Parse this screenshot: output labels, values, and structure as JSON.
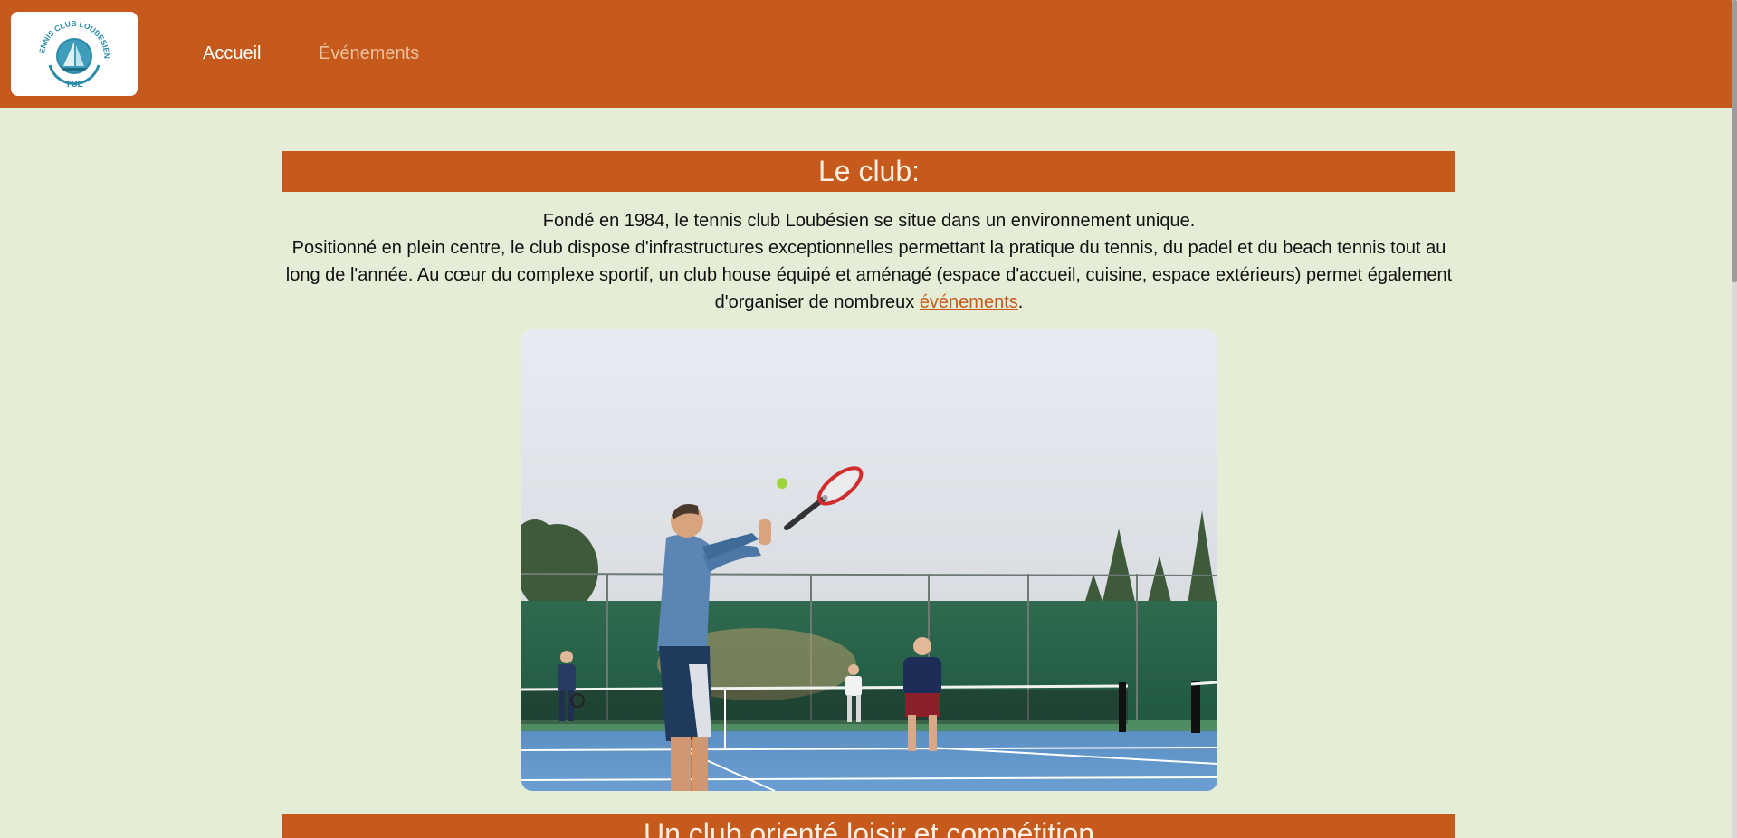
{
  "header": {
    "logo": {
      "top_text": "TENNIS CLUB LOUBESIEN",
      "bottom_text": "TCL",
      "icon": "sailboat-logo-icon",
      "colors": {
        "ring": "#2a8aa8",
        "disc": "#2a8aa8"
      }
    },
    "nav": {
      "accueil": "Accueil",
      "evenements": "Événements"
    },
    "colors": {
      "bar": "#c65a1c",
      "nav_active": "#ffffff",
      "nav_inactive": "#ecc09c"
    }
  },
  "club": {
    "title": "Le club:",
    "line1": "Fondé en 1984, le tennis club Loubésien se situe dans un environnement unique.",
    "line2_before_link": "Positionné en plein centre, le club dispose d'infrastructures exceptionnelles permettant la pratique du tennis, du padel et du beach tennis tout au long de l'année. Au cœur du complexe sportif, un club house équipé et aménagé (espace d'accueil, cuisine, espace extérieurs) permet également d'organiser de nombreux ",
    "link": "événements",
    "after_link": ".",
    "photo_icon": "tennis-players-photo"
  },
  "section2": {
    "title": "Un club orienté loisir et compétition"
  },
  "page": {
    "background": "#e6edd6",
    "accent": "#c65a1c"
  }
}
